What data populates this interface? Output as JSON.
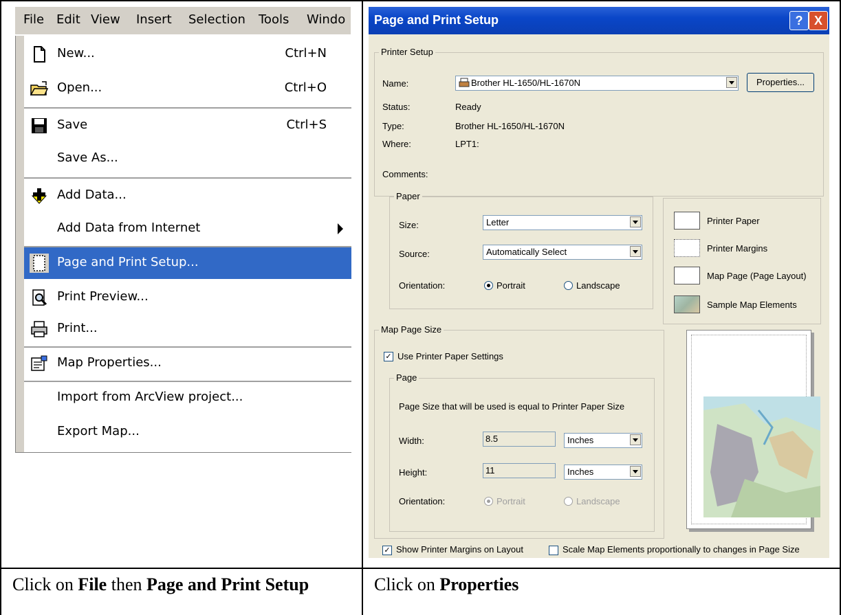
{
  "menu": {
    "menubar": [
      "File",
      "Edit",
      "View",
      "Insert",
      "Selection",
      "Tools",
      "Windo"
    ],
    "items": [
      {
        "label": "New...",
        "shortcut": "Ctrl+N"
      },
      {
        "label": "Open...",
        "shortcut": "Ctrl+O"
      },
      {
        "label": "Save",
        "shortcut": "Ctrl+S"
      },
      {
        "label": "Save As...",
        "shortcut": ""
      },
      {
        "label": "Add Data...",
        "shortcut": ""
      },
      {
        "label": "Add Data from Internet",
        "shortcut": ""
      },
      {
        "label": "Page and Print Setup...",
        "shortcut": ""
      },
      {
        "label": "Print Preview...",
        "shortcut": ""
      },
      {
        "label": "Print...",
        "shortcut": ""
      },
      {
        "label": "Map Properties...",
        "shortcut": ""
      },
      {
        "label": "Import from ArcView project...",
        "shortcut": ""
      },
      {
        "label": "Export Map...",
        "shortcut": ""
      }
    ]
  },
  "dialog": {
    "title": "Page and Print Setup",
    "help_glyph": "?",
    "close_glyph": "X",
    "printer_setup": {
      "group_label": "Printer Setup",
      "name_label": "Name:",
      "name_value": "Brother HL-1650/HL-1670N",
      "properties_button": "Properties...",
      "status_label": "Status:",
      "status_value": "Ready",
      "type_label": "Type:",
      "type_value": "Brother HL-1650/HL-1670N",
      "where_label": "Where:",
      "where_value": "LPT1:",
      "comments_label": "Comments:"
    },
    "paper": {
      "group_label": "Paper",
      "size_label": "Size:",
      "size_value": "Letter",
      "source_label": "Source:",
      "source_value": "Automatically Select",
      "orientation_label": "Orientation:",
      "portrait": "Portrait",
      "landscape": "Landscape"
    },
    "legend": {
      "printer_paper": "Printer Paper",
      "printer_margins": "Printer Margins",
      "map_page": "Map Page (Page Layout)",
      "sample_elements": "Sample Map Elements"
    },
    "map_page_size": {
      "group_label": "Map Page Size",
      "use_printer_settings": "Use Printer Paper Settings",
      "page_group_label": "Page",
      "page_note": "Page Size that will be used is equal to Printer Paper Size",
      "width_label": "Width:",
      "width_value": "8.5",
      "width_unit": "Inches",
      "height_label": "Height:",
      "height_value": "11",
      "height_unit": "Inches",
      "orientation_label": "Orientation:",
      "portrait": "Portrait",
      "landscape": "Landscape"
    },
    "show_margins": "Show Printer Margins on Layout",
    "scale_elements": "Scale Map Elements proportionally to changes in Page Size"
  },
  "captions": {
    "left": {
      "t1": "Click on ",
      "b1": "File",
      "t2": " then ",
      "b2": "Page and Print Setup"
    },
    "right": {
      "t1": "Click on ",
      "b1": "Properties"
    }
  },
  "colors": {
    "selection": "#3169c6",
    "title_bar": "#0a46c8",
    "dialog_bg": "#ece9d8"
  }
}
